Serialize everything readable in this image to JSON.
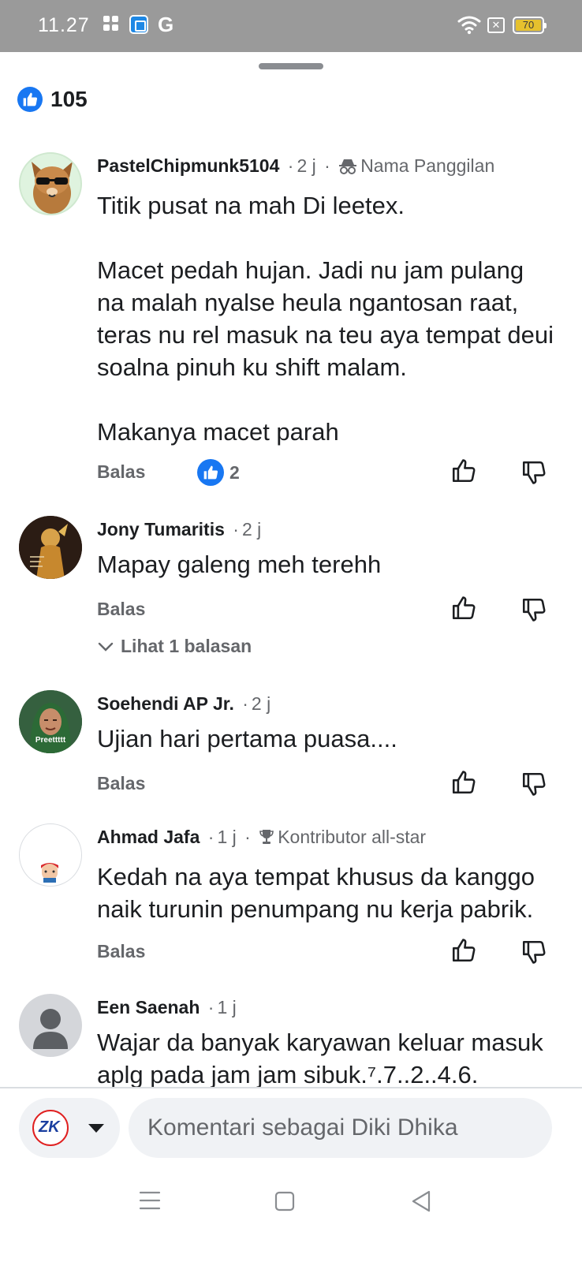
{
  "status_bar": {
    "time": "11.27",
    "app_icons": [
      "grid-app-icon",
      "blue-app-icon",
      "google-icon"
    ],
    "g_label": "G",
    "battery_level": "70",
    "battery_color": "#e6c12e"
  },
  "reactions": {
    "count": "105",
    "icon": "like-icon",
    "accent": "#1877f2"
  },
  "comments": [
    {
      "author": "PastelChipmunk5104",
      "time": "2 j",
      "badge": "Nama Panggilan",
      "badge_icon": "incognito-icon",
      "body": "Titik pusat na mah Di leetex.\n\nMacet pedah hujan. Jadi nu jam pulang na malah nyalse heula ngantosan raat, teras nu rel masuk na teu aya tempat deui soalna pinuh ku shift malam.\n\nMakanya macet parah",
      "reply": "Balas",
      "likes": "2"
    },
    {
      "author": "Jony Tumaritis",
      "time": "2 j",
      "body": "Mapay galeng meh terehh",
      "reply": "Balas",
      "view_replies": "Lihat 1 balasan"
    },
    {
      "author": "Soehendi AP Jr.",
      "time": "2 j",
      "avatar_caption": "Preettttt",
      "body": "Ujian hari pertama puasa....",
      "reply": "Balas"
    },
    {
      "author": "Ahmad Jafa",
      "time": "1 j",
      "badge": "Kontributor all-star",
      "badge_icon": "trophy-icon",
      "body": "Kedah na aya tempat khusus da kanggo naik turunin penumpang nu kerja pabrik.",
      "reply": "Balas"
    },
    {
      "author": "Een Saenah",
      "time": "1 j",
      "body": "Wajar da banyak karyawan keluar masuk aplg pada jam jam sibuk.⁷.7..2..4.6."
    }
  ],
  "composer": {
    "placeholder": "Komentari sebagai Diki Dhika",
    "profile_initials": "ZK"
  },
  "nav_bar": {
    "buttons": [
      "menu-icon",
      "home-icon",
      "back-icon"
    ]
  }
}
